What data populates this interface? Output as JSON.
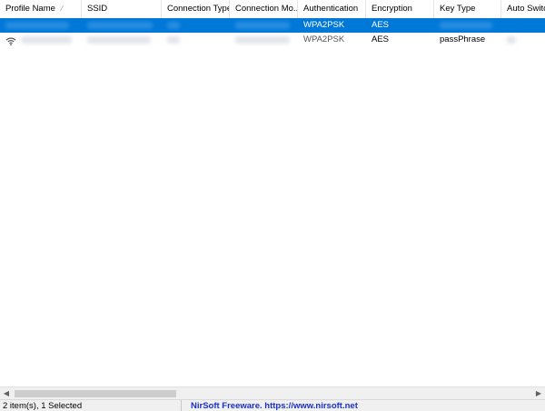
{
  "columns": [
    "Profile Name",
    "SSID",
    "Connection Type",
    "Connection Mo...",
    "Authentication",
    "Encryption",
    "Key Type",
    "Auto Switc"
  ],
  "sort_indicator": "⁄",
  "rows": [
    {
      "selected": true,
      "profile_name": "",
      "ssid": "",
      "connection_type": "",
      "connection_mode": "",
      "authentication": "WPA2PSK",
      "encryption": "AES",
      "key_type": "",
      "auto_switch": ""
    },
    {
      "selected": false,
      "profile_name": "",
      "ssid": "",
      "connection_type": "",
      "connection_mode": "",
      "authentication": "WPA2PSK",
      "encryption": "AES",
      "key_type": "passPhrase",
      "auto_switch": ""
    }
  ],
  "statusbar": {
    "items_text": "2 item(s), 1 Selected",
    "credit_text": "NirSoft Freeware. https://www.nirsoft.net"
  },
  "icons": {
    "row_icon": "wifi-icon",
    "scroll_left": "scroll-left-arrow-icon",
    "scroll_right": "scroll-right-arrow-icon"
  },
  "colors": {
    "selection": "#0078d7",
    "credit_link": "#1a2fcf"
  }
}
